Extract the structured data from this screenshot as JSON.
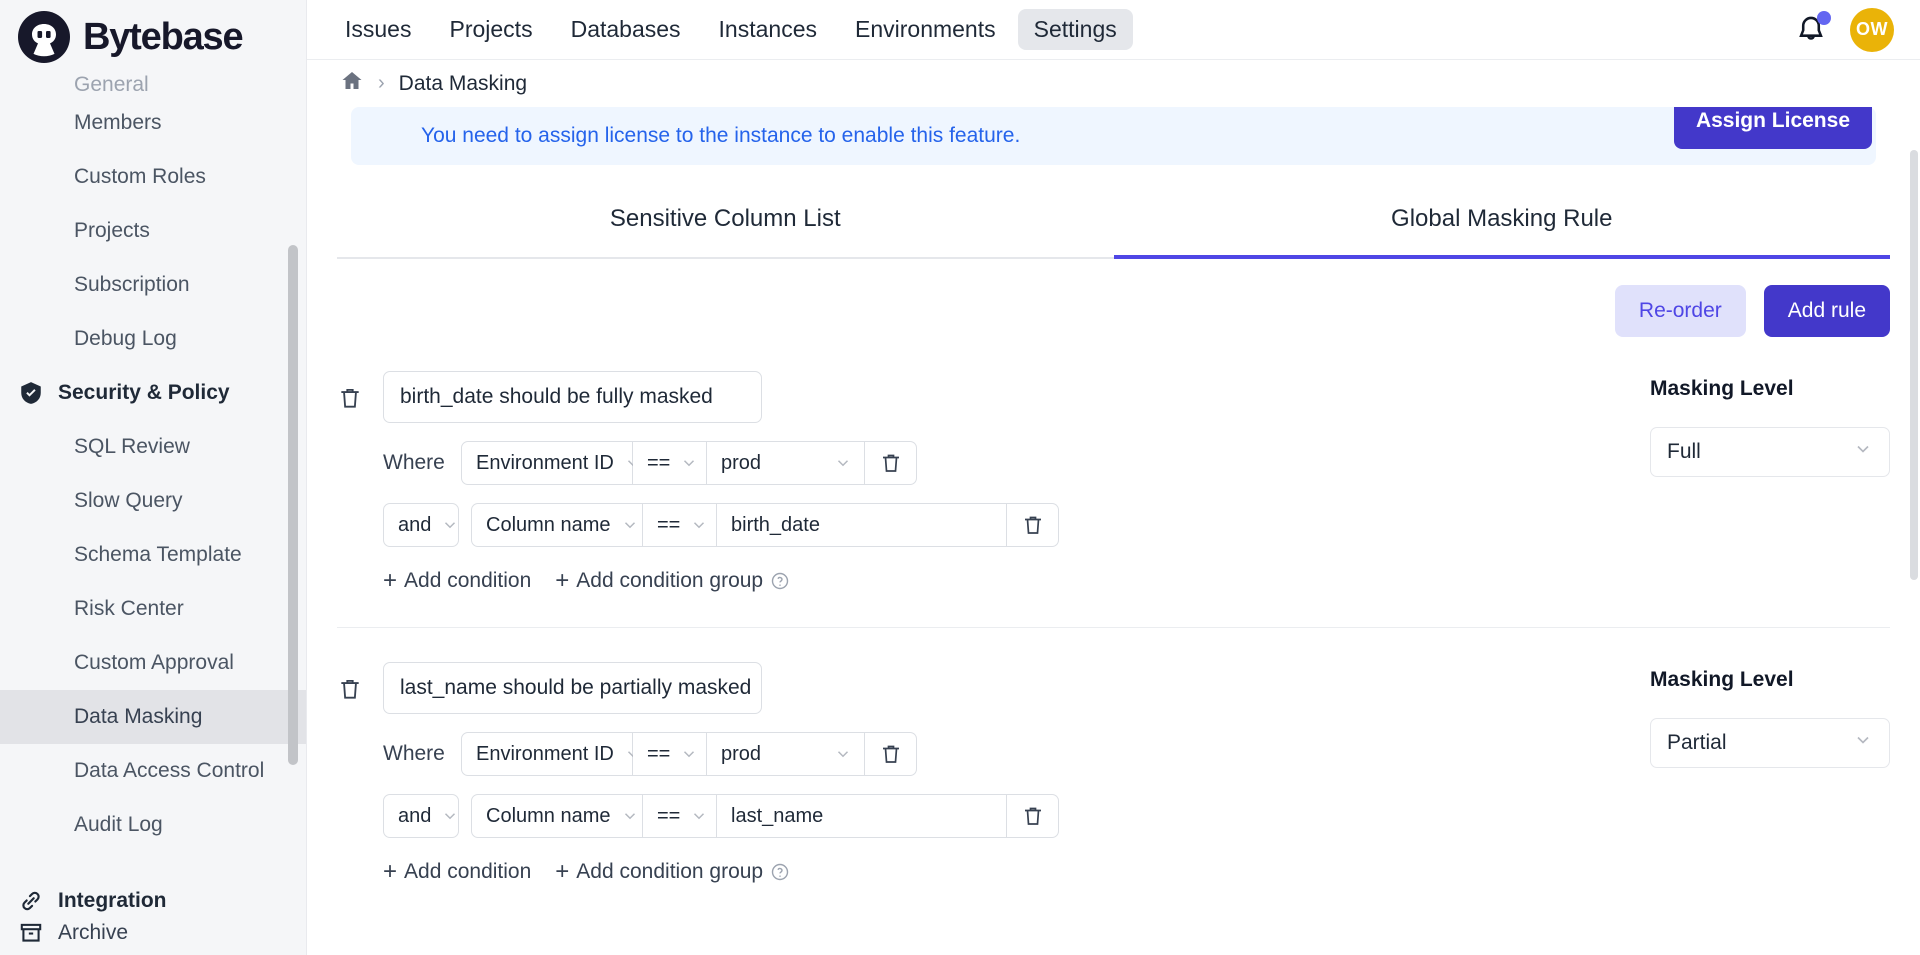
{
  "brand": {
    "name": "Bytebase",
    "logo_icon": "bytebase-mascot-logo"
  },
  "topnav": {
    "items": [
      {
        "label": "Issues",
        "active": false
      },
      {
        "label": "Projects",
        "active": false
      },
      {
        "label": "Databases",
        "active": false
      },
      {
        "label": "Instances",
        "active": false
      },
      {
        "label": "Environments",
        "active": false
      },
      {
        "label": "Settings",
        "active": true
      }
    ],
    "notification_icon": "bell-icon",
    "notification_badge": true,
    "avatar_initials": "OW"
  },
  "sidebar": {
    "items": [
      {
        "label": "General",
        "type": "sub",
        "state": "cut-off"
      },
      {
        "label": "Members",
        "type": "sub"
      },
      {
        "label": "Custom Roles",
        "type": "sub"
      },
      {
        "label": "Projects",
        "type": "sub"
      },
      {
        "label": "Subscription",
        "type": "sub"
      },
      {
        "label": "Debug Log",
        "type": "sub"
      },
      {
        "label": "Security & Policy",
        "type": "group",
        "icon": "shield-check-icon"
      },
      {
        "label": "SQL Review",
        "type": "sub"
      },
      {
        "label": "Slow Query",
        "type": "sub"
      },
      {
        "label": "Schema Template",
        "type": "sub"
      },
      {
        "label": "Risk Center",
        "type": "sub"
      },
      {
        "label": "Custom Approval",
        "type": "sub"
      },
      {
        "label": "Data Masking",
        "type": "sub",
        "active": true
      },
      {
        "label": "Data Access Control",
        "type": "sub"
      },
      {
        "label": "Audit Log",
        "type": "sub"
      }
    ],
    "bottom_items": [
      {
        "label": "Integration",
        "icon": "link-icon"
      },
      {
        "label": "Archive",
        "icon": "archive-box-icon"
      }
    ]
  },
  "breadcrumb": {
    "home_icon": "home-icon",
    "separator": "›",
    "current": "Data Masking"
  },
  "banner": {
    "message": "You need to assign license to the instance to enable this feature.",
    "button_label": "Assign License",
    "text_color": "#2563eb",
    "background": "#eff6ff",
    "button_color": "#4338ca"
  },
  "tabs": [
    {
      "label": "Sensitive Column List",
      "active": false
    },
    {
      "label": "Global Masking Rule",
      "active": true
    }
  ],
  "actions": {
    "reorder_label": "Re-order",
    "add_rule_label": "Add rule",
    "accent_color": "#4f46e5"
  },
  "common": {
    "where_label": "Where",
    "add_condition_label": "Add condition",
    "add_condition_group_label": "Add condition group",
    "masking_level_label": "Masking Level",
    "delete_icon": "trash-icon",
    "help_icon": "question-circle-icon",
    "chevron_icon": "chevron-down-icon",
    "plus_icon": "plus-icon"
  },
  "rules": [
    {
      "title": "birth_date should be fully masked",
      "conditions": [
        {
          "prefix": "Where",
          "field": "Environment ID",
          "operator": "==",
          "value": "prod",
          "value_type": "select"
        },
        {
          "prefix": "and",
          "field": "Column name",
          "operator": "==",
          "value": "birth_date",
          "value_type": "text"
        }
      ],
      "masking_level": "Full"
    },
    {
      "title": "last_name should be partially masked",
      "conditions": [
        {
          "prefix": "Where",
          "field": "Environment ID",
          "operator": "==",
          "value": "prod",
          "value_type": "select"
        },
        {
          "prefix": "and",
          "field": "Column name",
          "operator": "==",
          "value": "last_name",
          "value_type": "text"
        }
      ],
      "masking_level": "Partial"
    }
  ]
}
